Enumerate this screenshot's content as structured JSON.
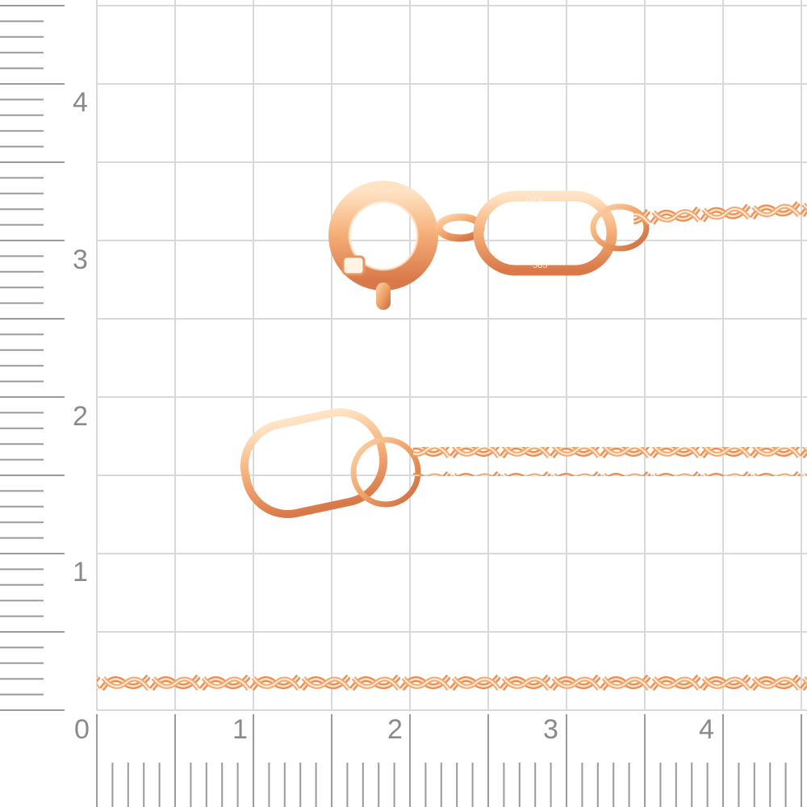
{
  "ruler": {
    "unit_hint": "cm",
    "x_labels": [
      "0",
      "1",
      "2",
      "3",
      "4"
    ],
    "y_labels": [
      "4",
      "3",
      "2",
      "1"
    ]
  },
  "colors": {
    "grid": "#d9d9d9",
    "ruler_ticks": "#9a9a9a",
    "label": "#8a8a8a",
    "gold_light": "#ffd9b0",
    "gold_mid": "#f3a56b",
    "gold_dark": "#d9794a"
  },
  "subject": {
    "item": "rose-gold-singapore-chain",
    "parts": [
      "spring-ring-clasp",
      "tag-link",
      "end-ring",
      "jump-ring",
      "twisted-chain"
    ]
  }
}
